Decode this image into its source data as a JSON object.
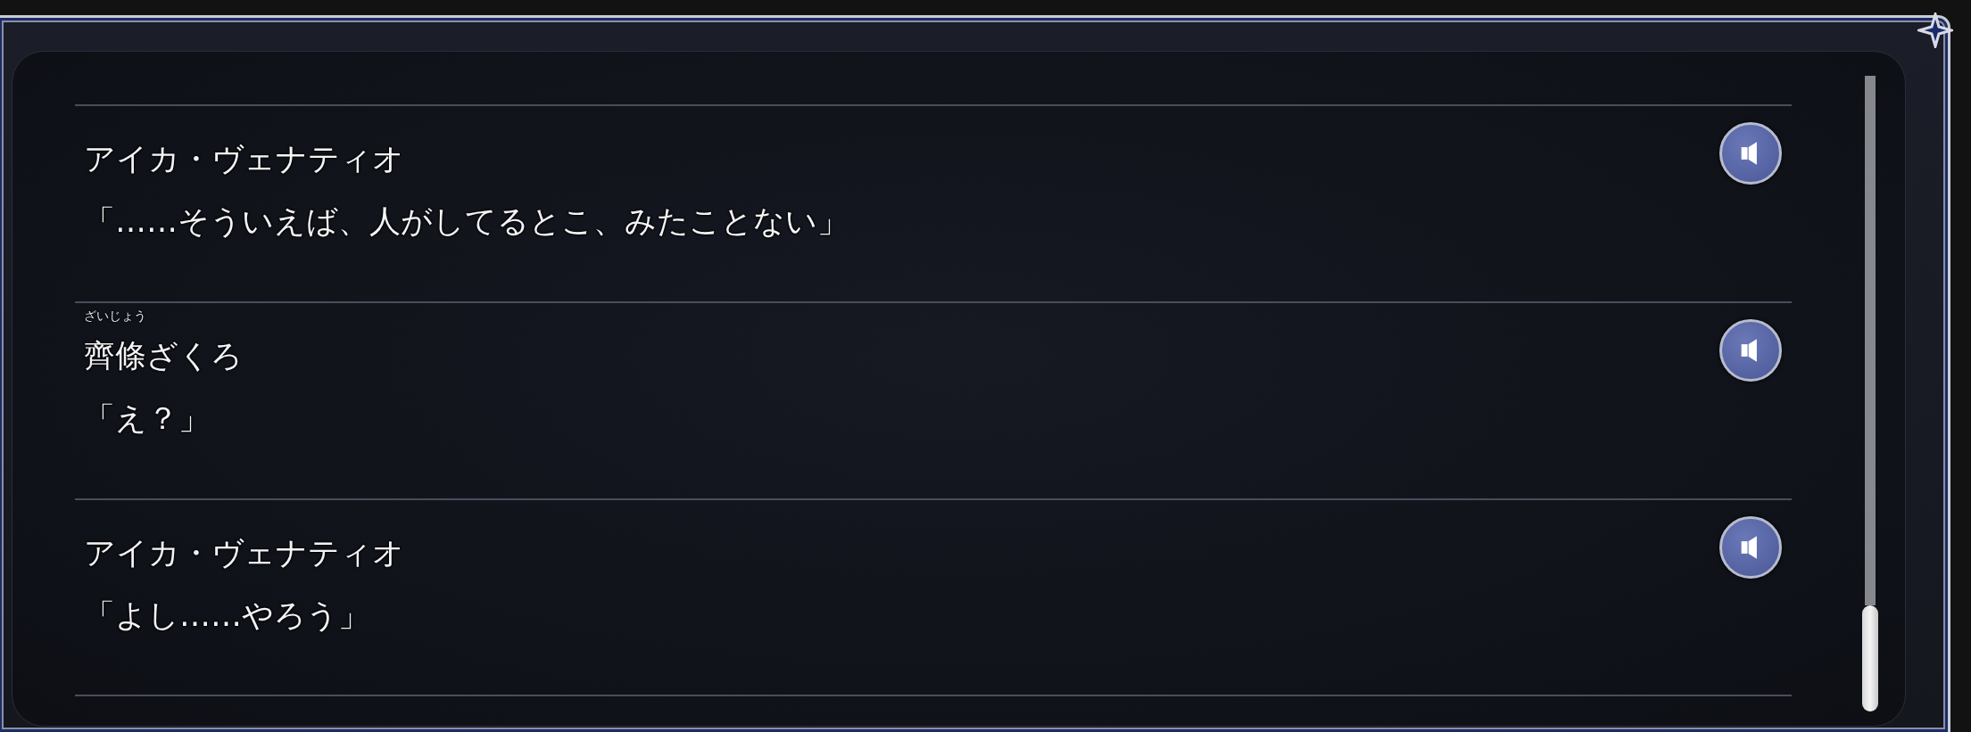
{
  "log": [
    {
      "speaker": "アイカ・ヴェナティオ",
      "line": "「……そういえば、人がしてるとこ、みたことない」"
    },
    {
      "speaker": "齊條ざくろ",
      "speaker_ruby": "ざいじょう",
      "line": "「え？」"
    },
    {
      "speaker": "アイカ・ヴェナティオ",
      "line": "「よし……やろう」"
    }
  ]
}
